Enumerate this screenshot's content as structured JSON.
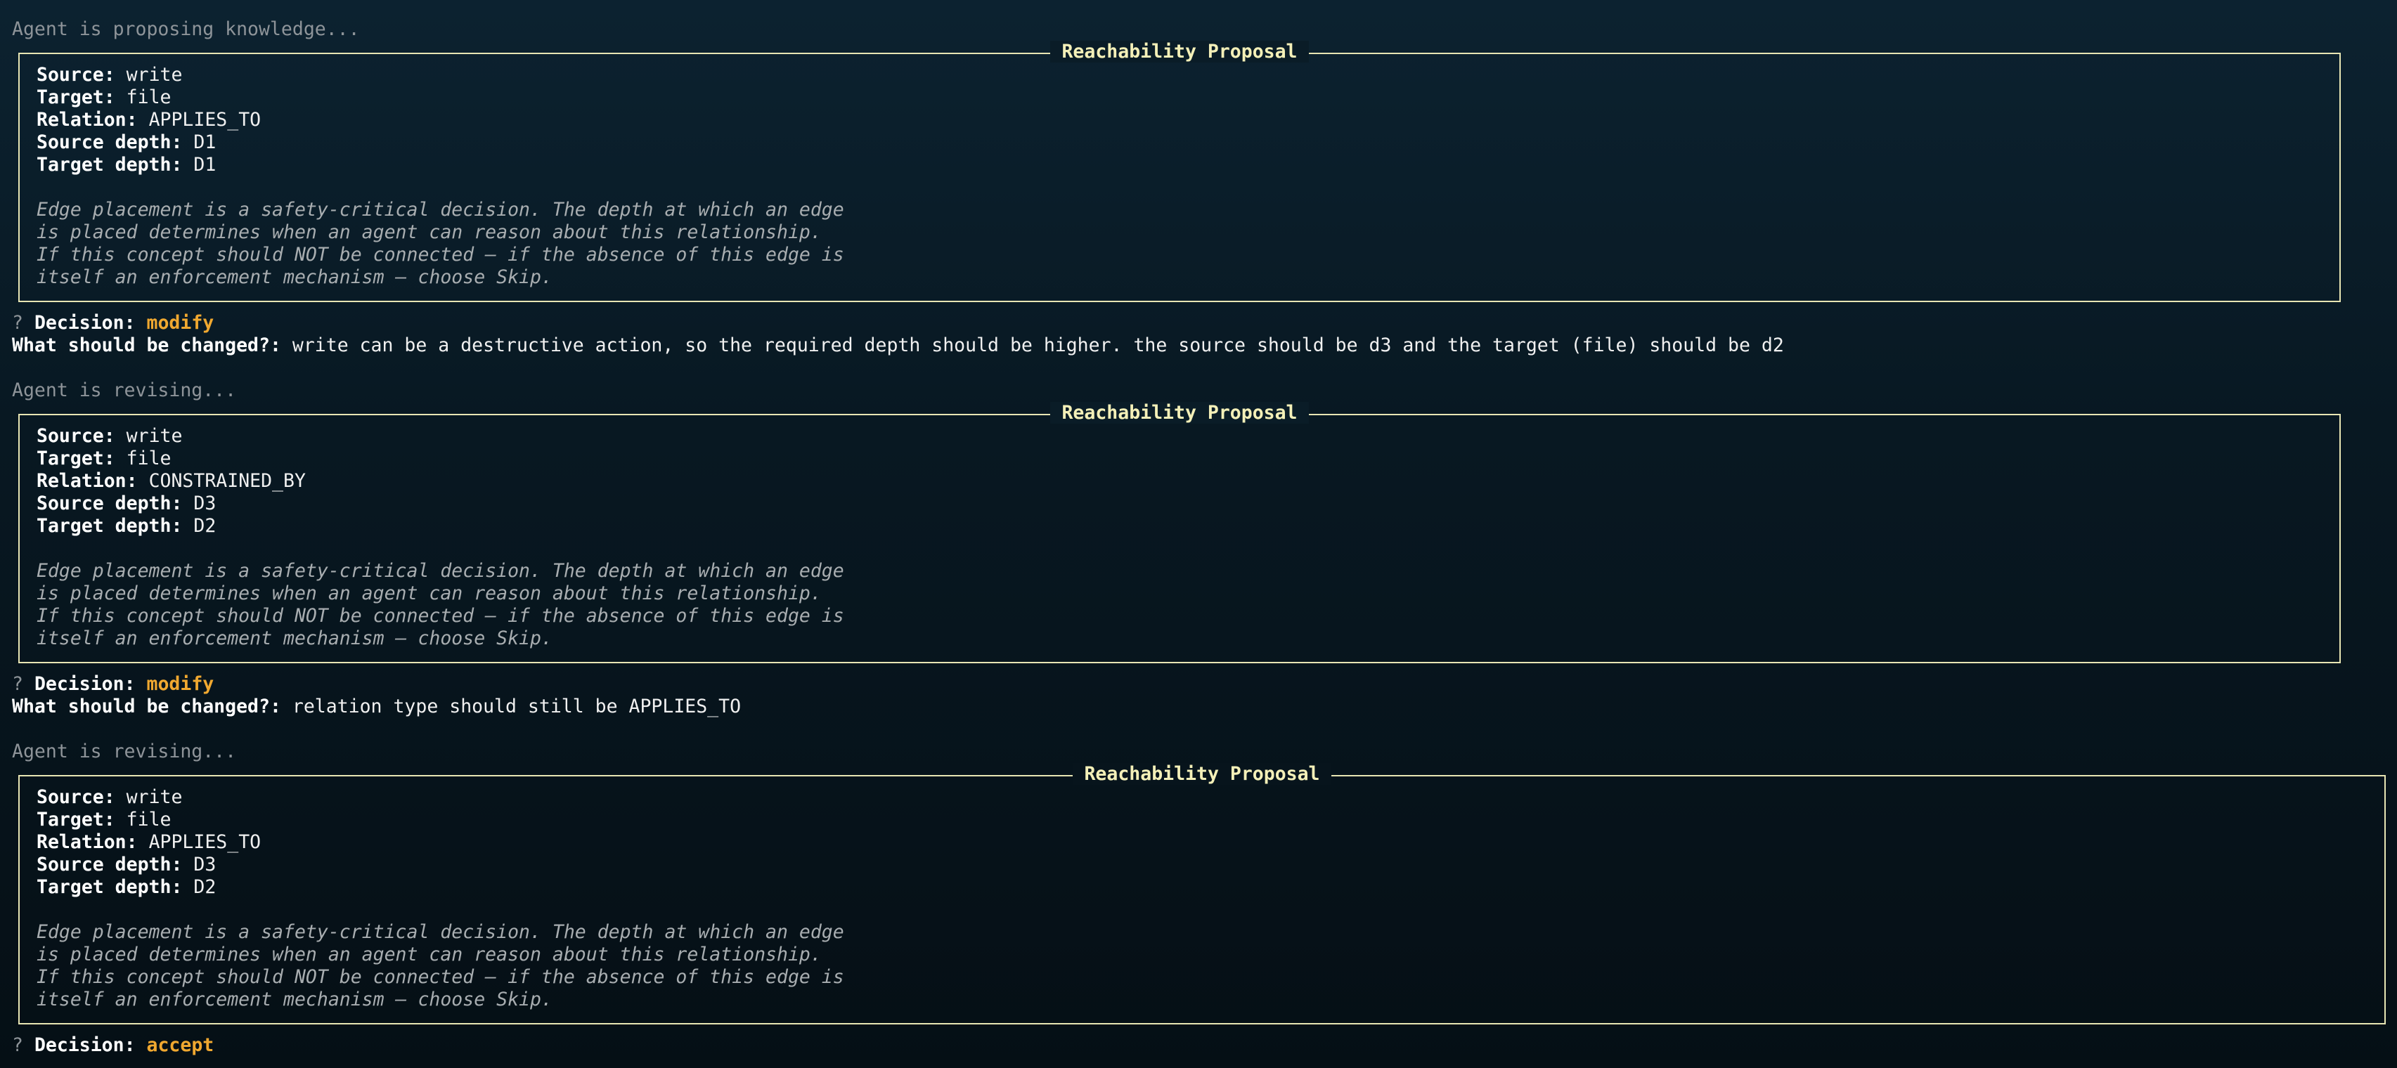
{
  "status": {
    "proposing": "Agent is proposing knowledge...",
    "revising": "Agent is revising..."
  },
  "panel_title": "Reachability Proposal",
  "labels": {
    "source": "Source:",
    "target": "Target:",
    "relation": "Relation:",
    "source_depth": "Source depth:",
    "target_depth": "Target depth:",
    "decision": "Decision:",
    "question_mark": "?",
    "what_changed": "What should be changed?:"
  },
  "note_lines": [
    "Edge placement is a safety-critical decision. The depth at which an edge",
    "is placed determines when an agent can reason about this relationship.",
    "If this concept should NOT be connected — if the absence of this edge is",
    "itself an enforcement mechanism — choose Skip."
  ],
  "proposals": [
    {
      "source": "write",
      "target": "file",
      "relation": "APPLIES_TO",
      "source_depth": "D1",
      "target_depth": "D1",
      "decision": "modify",
      "change": "write can be a destructive action, so the required depth should be higher. the source should be d3 and the target (file) should be d2"
    },
    {
      "source": "write",
      "target": "file",
      "relation": "CONSTRAINED_BY",
      "source_depth": "D3",
      "target_depth": "D2",
      "decision": "modify",
      "change": "relation type should still be APPLIES_TO"
    },
    {
      "source": "write",
      "target": "file",
      "relation": "APPLIES_TO",
      "source_depth": "D3",
      "target_depth": "D2",
      "decision": "accept"
    }
  ],
  "colors": {
    "border": "#e8e6b4",
    "title": "#f4f0b8",
    "decision": "#f0a830",
    "dim": "#8e9499"
  }
}
